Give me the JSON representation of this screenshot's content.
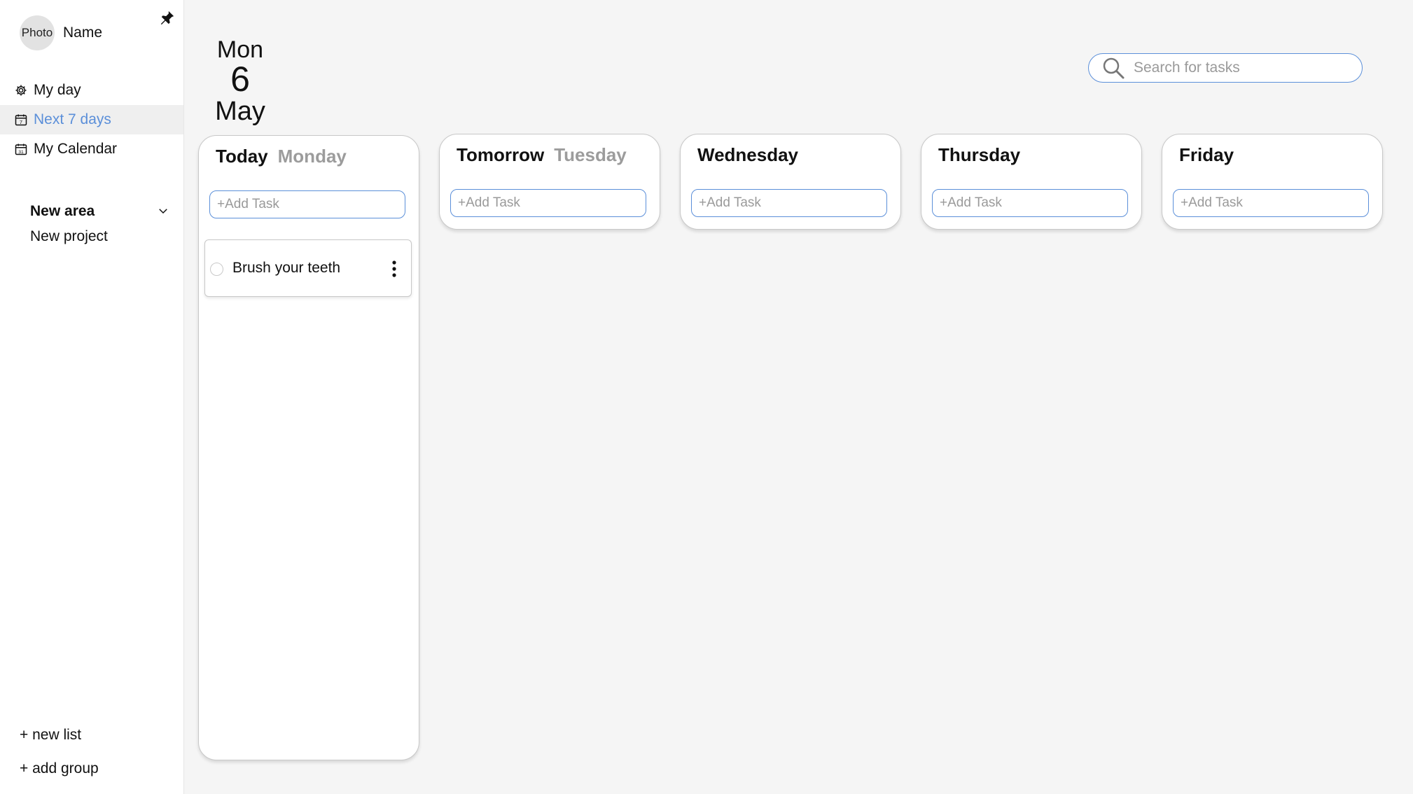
{
  "profile": {
    "photo_label": "Photo",
    "name": "Name"
  },
  "nav": {
    "items": [
      {
        "label": "My day",
        "icon": "gear-icon",
        "active": false
      },
      {
        "label": "Next 7 days",
        "icon": "calendar-7-icon",
        "active": true
      },
      {
        "label": "My Calendar",
        "icon": "calendar-31-icon",
        "active": false
      }
    ]
  },
  "area": {
    "title": "New area",
    "project": "New project"
  },
  "sidebar_footer": {
    "new_list": "+ new list",
    "add_group": "+ add group"
  },
  "date": {
    "weekday": "Mon",
    "day": "6",
    "month": "May"
  },
  "search": {
    "placeholder": "Search for tasks"
  },
  "columns": [
    {
      "title": "Today",
      "subtitle": "Monday",
      "add_placeholder": "+Add Task",
      "tasks": [
        {
          "text": "Brush your teeth",
          "done": false
        }
      ]
    },
    {
      "title": "Tomorrow",
      "subtitle": "Tuesday",
      "add_placeholder": "+Add Task",
      "tasks": []
    },
    {
      "title": "Wednesday",
      "subtitle": "",
      "add_placeholder": "+Add Task",
      "tasks": []
    },
    {
      "title": "Thursday",
      "subtitle": "",
      "add_placeholder": "+Add Task",
      "tasks": []
    },
    {
      "title": "Friday",
      "subtitle": "",
      "add_placeholder": "+Add Task",
      "tasks": []
    }
  ],
  "colors": {
    "accent": "#5b8fd9",
    "active_bg": "#efefef",
    "muted_text": "#9c9c9c"
  }
}
